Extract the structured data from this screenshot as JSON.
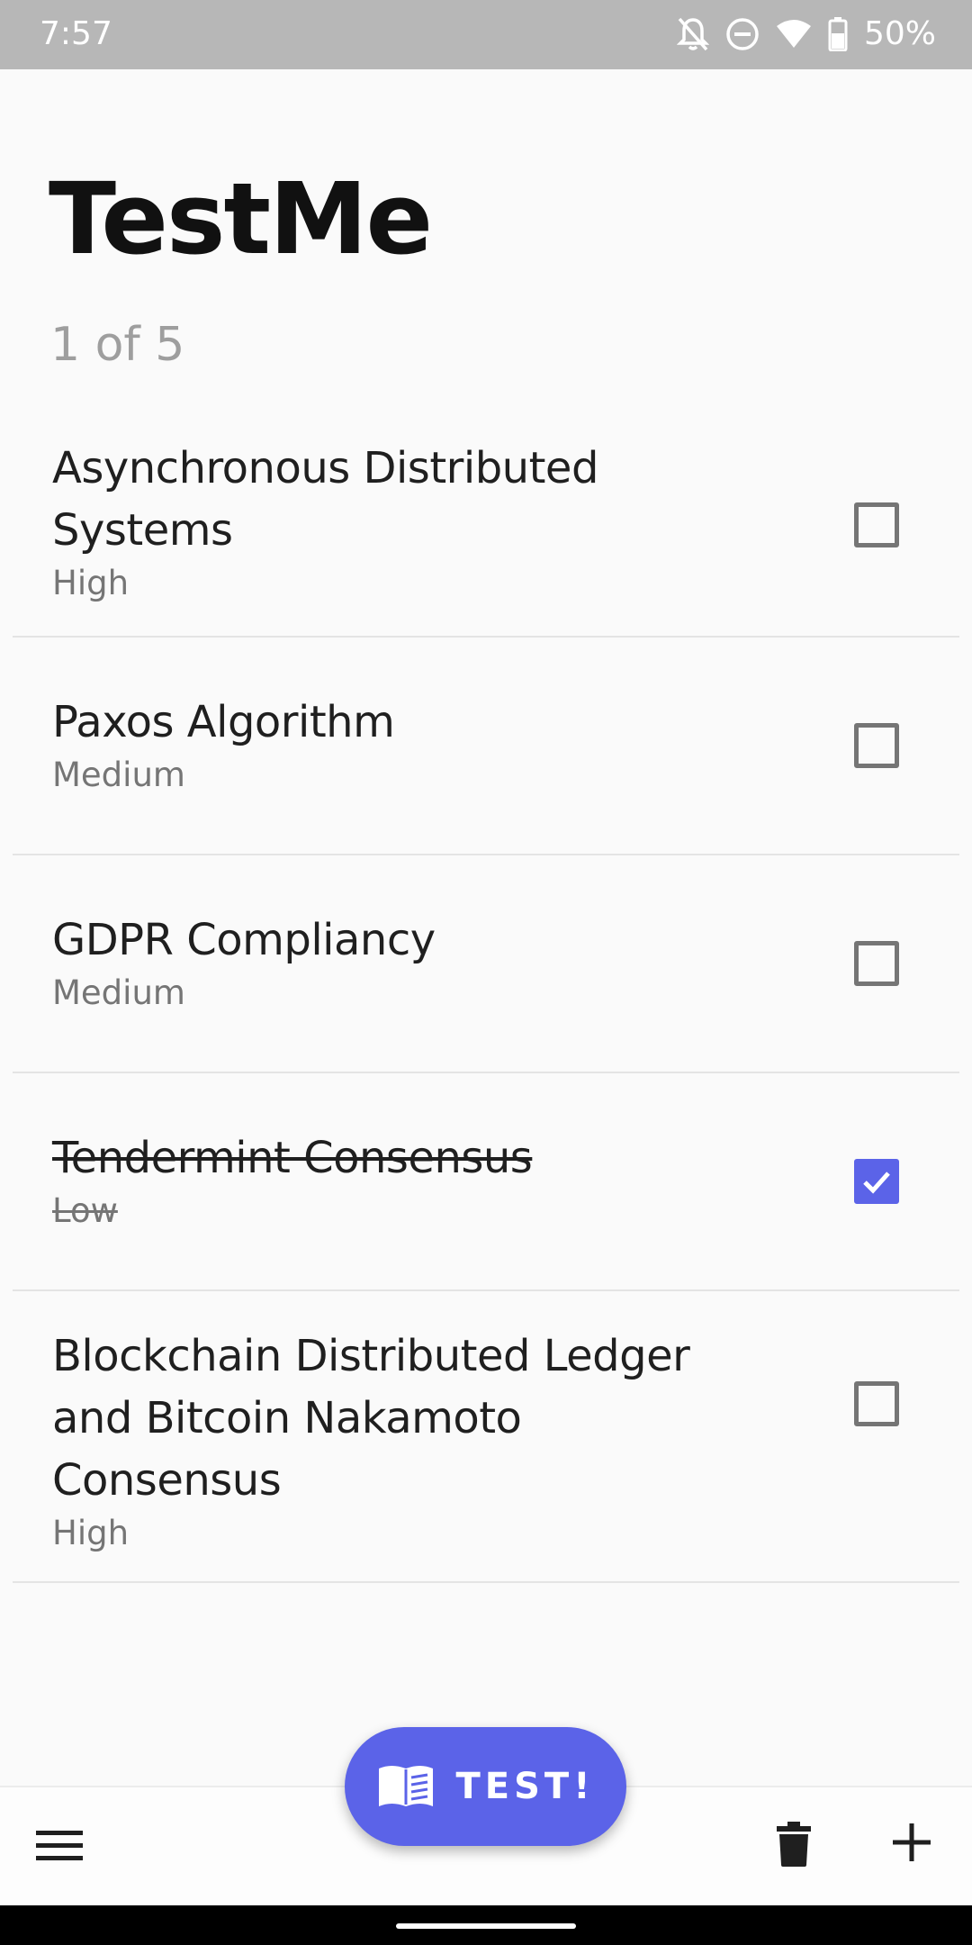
{
  "status_bar": {
    "time": "7:57",
    "battery": "50%",
    "icons": [
      "notifications-off-icon",
      "do-not-disturb-icon",
      "wifi-icon",
      "battery-icon"
    ]
  },
  "app": {
    "title": "TestMe",
    "progress": "1 of 5"
  },
  "topics": [
    {
      "title": "Asynchronous Distributed Systems",
      "priority": "High",
      "checked": false
    },
    {
      "title": "Paxos Algorithm",
      "priority": "Medium",
      "checked": false
    },
    {
      "title": "GDPR Compliancy",
      "priority": "Medium",
      "checked": false
    },
    {
      "title": "Tendermint Consensus",
      "priority": "Low",
      "checked": true
    },
    {
      "title": "Blockchain Distributed Ledger and Bitcoin Nakamoto Consensus",
      "priority": "High",
      "checked": false
    }
  ],
  "fab": {
    "label": "TEST!",
    "icon": "book-icon"
  },
  "bottom_bar": {
    "icons": [
      "menu-icon",
      "delete-icon",
      "add-icon"
    ]
  },
  "colors": {
    "accent": "#5b63e8",
    "status_bar": "#b7b7b7",
    "background": "#fafafa",
    "secondary_text": "#757575"
  }
}
